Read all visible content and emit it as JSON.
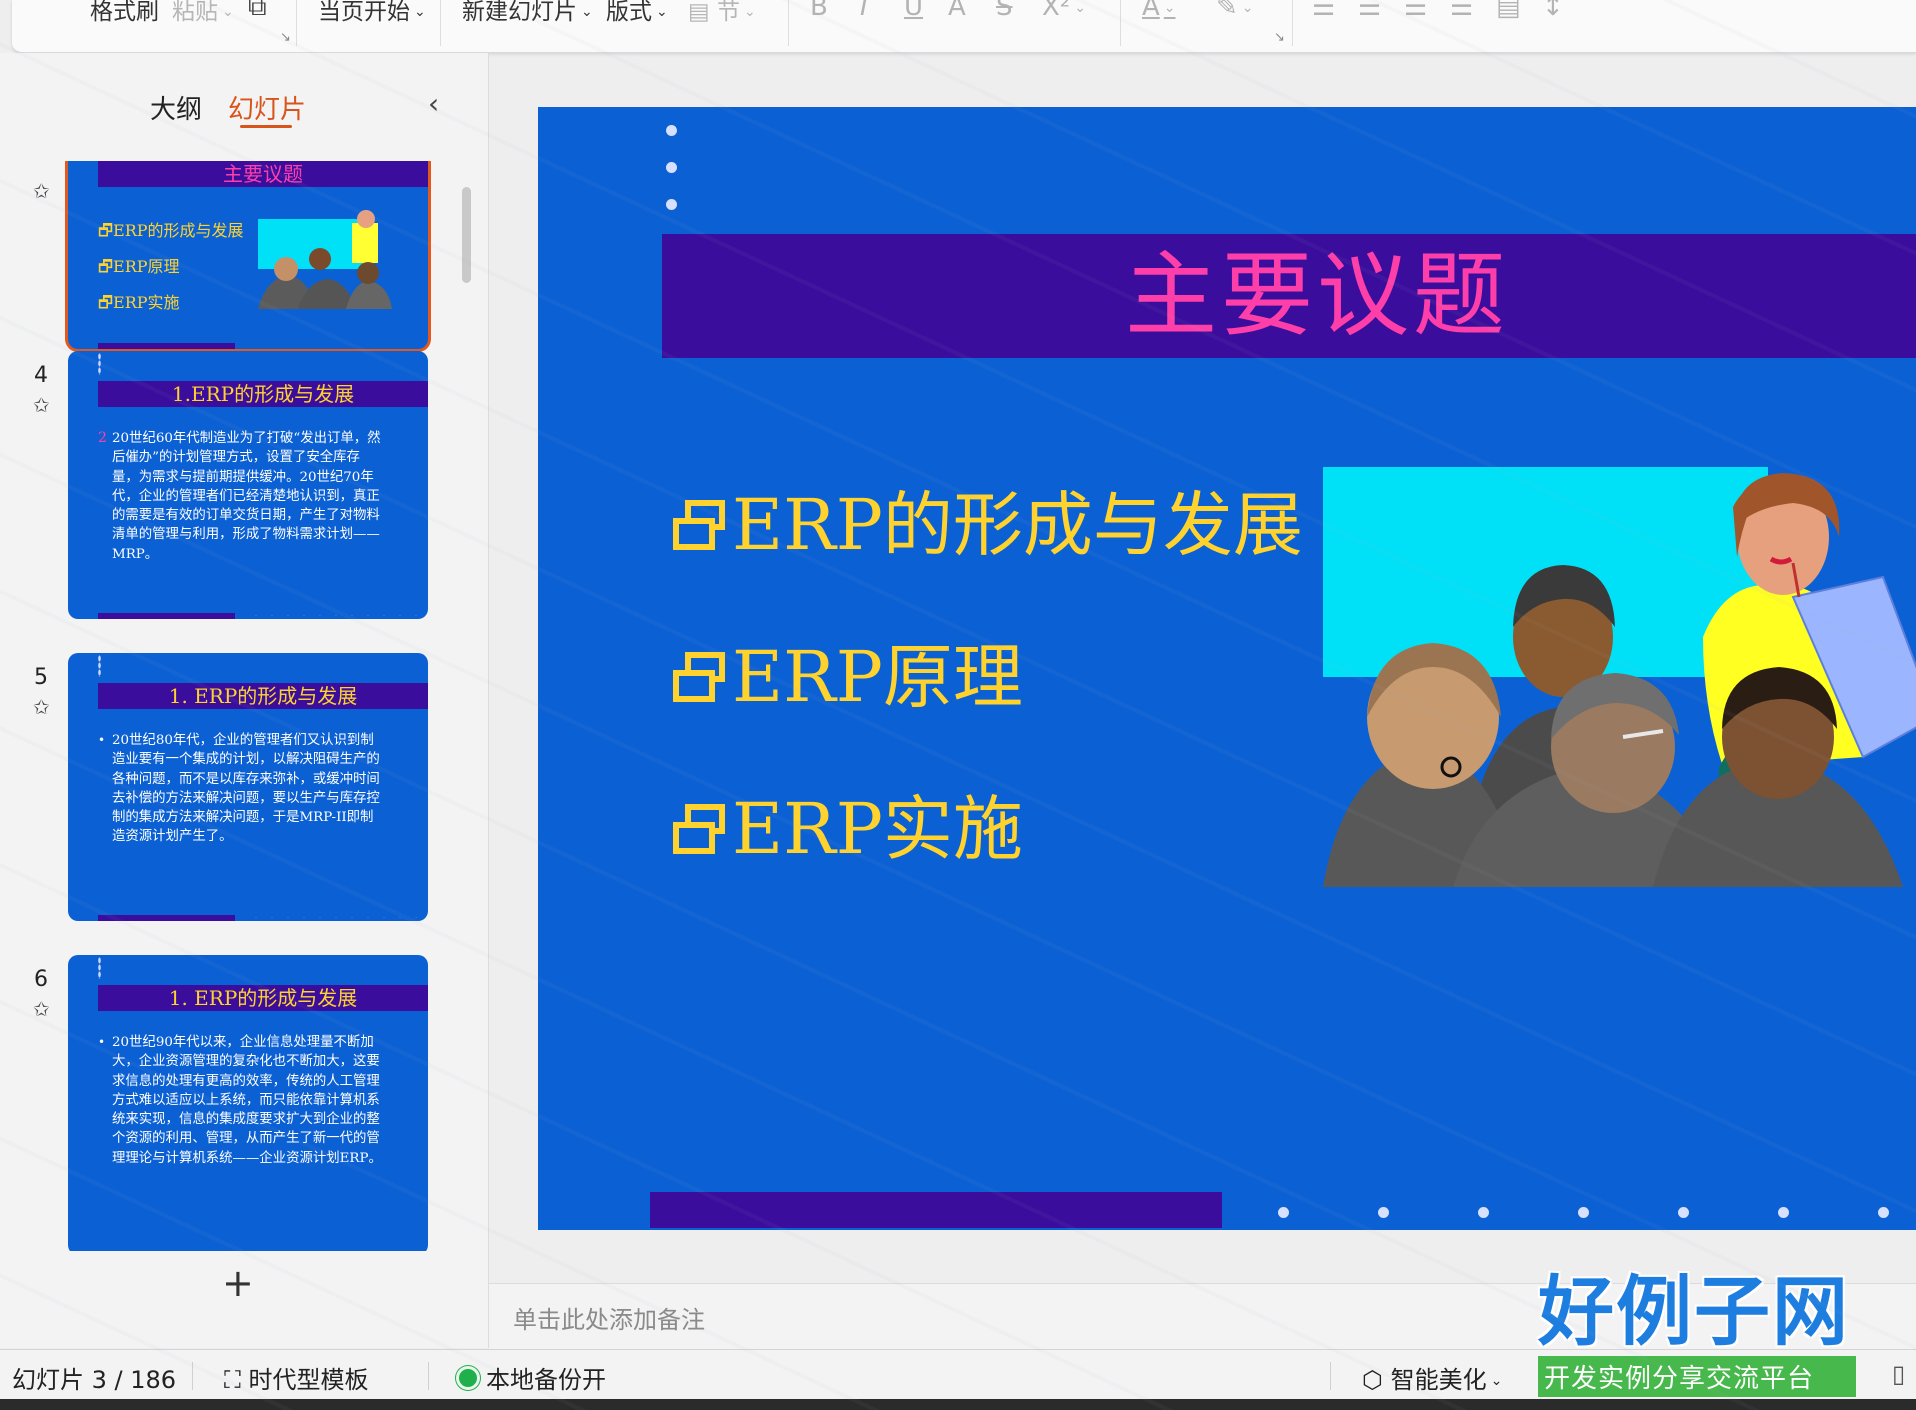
{
  "toolbar": {
    "format_painter": "格式刷",
    "paste": "粘贴",
    "from_current": "当页开始",
    "new_slide": "新建幻灯片",
    "layout": "版式",
    "section": "节",
    "bold": "B",
    "italic": "I",
    "underline": "U",
    "strike": "S",
    "superscript": "X²",
    "font_color": "A"
  },
  "left_panel": {
    "tab_outline": "大纲",
    "tab_slides": "幻灯片",
    "thumbnails": [
      {
        "num": "",
        "title": "主要议题",
        "items": [
          "ERP的形成与发展",
          "ERP原理",
          "ERP实施"
        ],
        "selected": true
      },
      {
        "num": "4",
        "title": "1.ERP的形成与发展",
        "bullet": "2",
        "body": "20世纪60年代制造业为了打破“发出订单，然后催办”的计划管理方式，设置了安全库存量，为需求与提前期提供缓冲。20世纪70年代，企业的管理者们已经清楚地认识到，真正的需要是有效的订单交货日期，产生了对物料清单的管理与利用，形成了物料需求计划——MRP。"
      },
      {
        "num": "5",
        "title": "1. ERP的形成与发展",
        "bullet": "•",
        "body": "20世纪80年代，企业的管理者们又认识到制造业要有一个集成的计划，以解决阻碍生产的各种问题，而不是以库存来弥补，或缓冲时间去补偿的方法来解决问题，要以生产与库存控制的集成方法来解决问题，于是MRP-II即制造资源计划产生了。"
      },
      {
        "num": "6",
        "title": "1. ERP的形成与发展",
        "bullet": "•",
        "body": "20世纪90年代以来，企业信息处理量不断加大，企业资源管理的复杂化也不断加大，这要求信息的处理有更高的效率，传统的人工管理方式难以适应以上系统，而只能依靠计算机系统来实现，信息的集成度要求扩大到企业的整个资源的利用、管理，从而产生了新一代的管理理论与计算机系统——企业资源计划ERP。"
      }
    ],
    "add_label": "+"
  },
  "slide": {
    "title": "主要议题",
    "items": [
      "ERP的形成与发展",
      "ERP原理",
      "ERP实施"
    ],
    "colors": {
      "background": "#0b61d4",
      "bar": "#3b0d9c",
      "title": "#ff3fa9",
      "text": "#ffd22e",
      "screen": "#00e1f7"
    }
  },
  "notes": {
    "placeholder": "单击此处添加备注"
  },
  "statusbar": {
    "slide_counter": "幻灯片 3 / 186",
    "template": "时代型模板",
    "backup": "本地备份开",
    "beautify": "智能美化"
  },
  "logo": {
    "main": "好例子网",
    "sub": "开发实例分享交流平台"
  }
}
